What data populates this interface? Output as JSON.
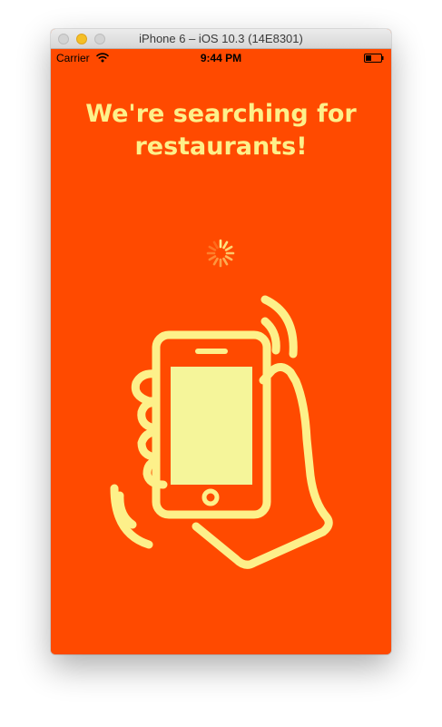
{
  "window": {
    "title": "iPhone 6 – iOS 10.3 (14E8301)"
  },
  "status_bar": {
    "carrier": "Carrier",
    "time": "9:44 PM",
    "wifi_icon": "wifi-icon",
    "battery_icon": "battery-icon"
  },
  "screen": {
    "headline": "We're searching for\nrestaurants!",
    "spinner_icon": "activity-spinner-icon",
    "illustration_icon": "hand-holding-vibrating-phone-icon"
  },
  "colors": {
    "background": "#ff4a00",
    "accent": "#fdf08a",
    "phone_screen": "#f5f59a"
  }
}
